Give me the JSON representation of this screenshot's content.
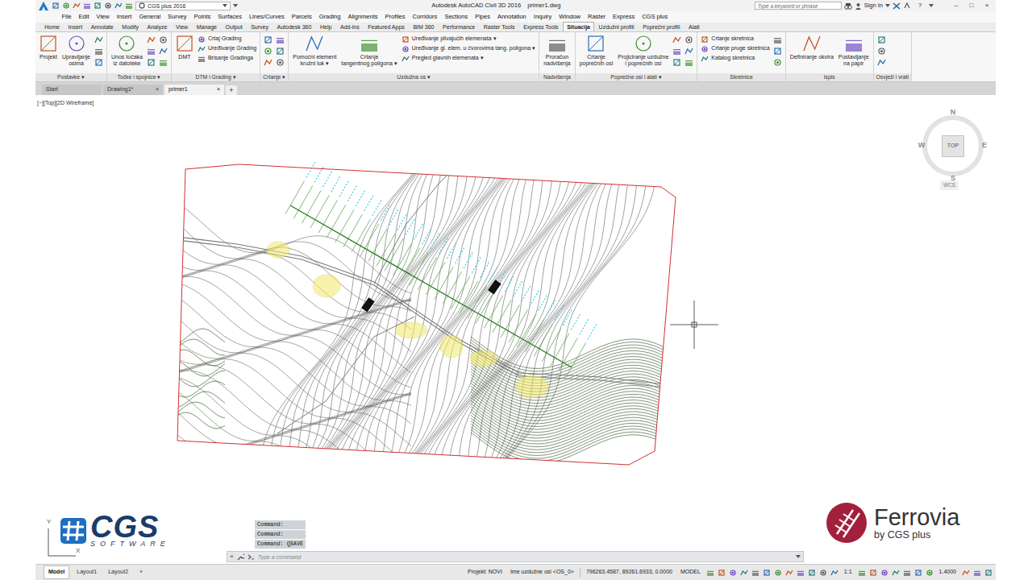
{
  "window": {
    "title": "Autodesk AutoCAD Civil 3D 2016",
    "file": "primer1.dwg",
    "workspace": "CGS plus 2016",
    "search_placeholder": "Type a keyword or phrase",
    "sign_in": "Sign In",
    "help": "?",
    "controls": [
      "–",
      "□",
      "×"
    ]
  },
  "menu": [
    "File",
    "Edit",
    "View",
    "Insert",
    "General",
    "Survey",
    "Points",
    "Surfaces",
    "Lines/Curves",
    "Parcels",
    "Grading",
    "Alignments",
    "Profiles",
    "Corridors",
    "Sections",
    "Pipes",
    "Annotation",
    "Inquiry",
    "Window",
    "Raster",
    "Express",
    "CGS plus"
  ],
  "ribbon_tabs": [
    {
      "label": "Home",
      "selected": false
    },
    {
      "label": "Insert",
      "selected": false
    },
    {
      "label": "Annotate",
      "selected": false
    },
    {
      "label": "Modify",
      "selected": false
    },
    {
      "label": "Analyze",
      "selected": false
    },
    {
      "label": "View",
      "selected": false
    },
    {
      "label": "Manage",
      "selected": false
    },
    {
      "label": "Output",
      "selected": false
    },
    {
      "label": "Survey",
      "selected": false
    },
    {
      "label": "Autodesk 360",
      "selected": false
    },
    {
      "label": "Help",
      "selected": false
    },
    {
      "label": "Add-ins",
      "selected": false
    },
    {
      "label": "Featured Apps",
      "selected": false
    },
    {
      "label": "BIM 360",
      "selected": false
    },
    {
      "label": "Performance",
      "selected": false
    },
    {
      "label": "Raster Tools",
      "selected": false
    },
    {
      "label": "Express Tools",
      "selected": false
    },
    {
      "label": "Situacija",
      "selected": true
    },
    {
      "label": "Uzdužni profili",
      "selected": false
    },
    {
      "label": "Poprečni profili",
      "selected": false
    },
    {
      "label": "Alati",
      "selected": false
    }
  ],
  "ribbon_groups": [
    {
      "label": "Postavke",
      "arrow": "▾",
      "items": [
        {
          "kind": "large",
          "lines": [
            "Projekt"
          ]
        },
        {
          "kind": "large",
          "lines": [
            "Upravljanje",
            "osima"
          ]
        },
        {
          "kind": "icons"
        }
      ]
    },
    {
      "label": "Točke i spojnice",
      "arrow": "▾",
      "items": [
        {
          "kind": "large",
          "lines": [
            "Unos točaka",
            "iz datoteke"
          ]
        },
        {
          "kind": "icons"
        },
        {
          "kind": "icons"
        }
      ]
    },
    {
      "label": "DTM i Grading",
      "arrow": "▾",
      "items": [
        {
          "kind": "large",
          "lines": [
            "DMT"
          ]
        },
        {
          "kind": "list",
          "entries": [
            "Crtaj Grading",
            "Uređivanje Grading",
            "Brisanje Gradinga"
          ]
        }
      ]
    },
    {
      "label": "Crtanje",
      "arrow": "▾",
      "items": [
        {
          "kind": "icons"
        },
        {
          "kind": "icons"
        }
      ]
    },
    {
      "label": "Uzdužna os",
      "arrow": "▾",
      "items": [
        {
          "kind": "large",
          "lines": [
            "Pomoćni element",
            "kružni luk ▾"
          ]
        },
        {
          "kind": "large",
          "lines": [
            "Crtanje",
            "tangentnog poligona ▾"
          ]
        },
        {
          "kind": "list",
          "entries": [
            "Uređivanje plivajućih elemenata ▾",
            "Uređivanje gl. elem. u čvorovima tang. poligona ▾",
            "Pregled glavnih elemenata ▾"
          ]
        }
      ]
    },
    {
      "label": "Nadvišenja",
      "arrow": "",
      "items": [
        {
          "kind": "large",
          "lines": [
            "Proračun",
            "nadvišenja"
          ]
        }
      ]
    },
    {
      "label": "Poprečne osi i alati",
      "arrow": "▾",
      "items": [
        {
          "kind": "large",
          "lines": [
            "Crtanje",
            "poprečnih osi"
          ]
        },
        {
          "kind": "large",
          "lines": [
            "Projiciranje uzdužne",
            "i poprečnih osi"
          ]
        },
        {
          "kind": "icons"
        },
        {
          "kind": "icons"
        }
      ]
    },
    {
      "label": "Skretnice",
      "arrow": "",
      "items": [
        {
          "kind": "list",
          "entries": [
            "Crtanje skretnica",
            "Crtanje pruge skretnica",
            "Katalog skretnica"
          ]
        },
        {
          "kind": "icons"
        }
      ]
    },
    {
      "label": "Ispis",
      "arrow": "",
      "items": [
        {
          "kind": "large",
          "lines": [
            "Definiranje okvira"
          ]
        },
        {
          "kind": "large",
          "lines": [
            "Postavljanje",
            "na papir"
          ]
        }
      ]
    },
    {
      "label": "Osvježi i vrati",
      "arrow": "",
      "items": [
        {
          "kind": "icons"
        }
      ]
    }
  ],
  "file_tabs": [
    {
      "label": "Start",
      "selected": false,
      "close": ""
    },
    {
      "label": "Drawing1*",
      "selected": false,
      "close": "×"
    },
    {
      "label": "primer1",
      "selected": true,
      "close": "×"
    }
  ],
  "file_tab_add": "+",
  "viewport": {
    "label": "[−][Top][2D Wireframe]"
  },
  "viewcube": {
    "north": "N",
    "south": "S",
    "east": "E",
    "west": "W",
    "face": "TOP",
    "ucs": "WCS"
  },
  "ucs_icon": {
    "y": "Y",
    "x": "X"
  },
  "logos": {
    "cgs": "CGS",
    "cgs_sub": "SOFTWARE",
    "ferrovia": "Ferrovia",
    "ferrovia_sub": "by CGS plus"
  },
  "command": {
    "history": [
      "Command:",
      "Command:",
      "Command:  QSAVE"
    ],
    "placeholder": "Type a command",
    "close": "×"
  },
  "status": {
    "layouts": [
      {
        "label": "Model",
        "selected": true
      },
      {
        "label": "Layout1",
        "selected": false
      },
      {
        "label": "Layout2",
        "selected": false
      }
    ],
    "add": "+",
    "project": "Projekt: NOVI",
    "axis": "Ime uzdužne osi <OS_0>",
    "coords": "796263.4587, 89261.6933, 0.0000",
    "space": "MODEL",
    "scale": "1:1",
    "lineweight": "1.4000"
  }
}
